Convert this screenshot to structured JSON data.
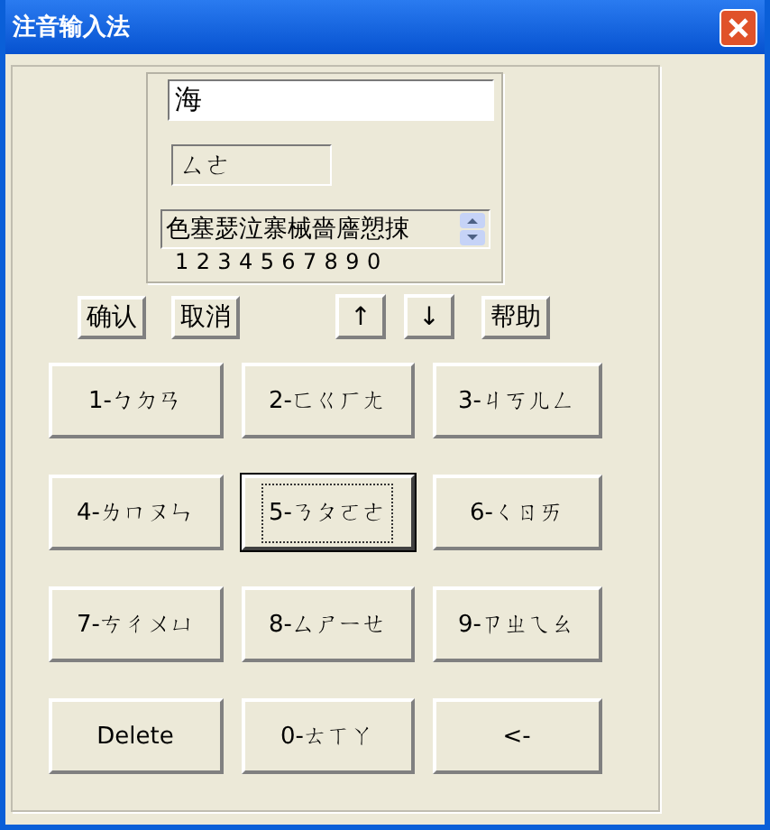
{
  "window": {
    "title": "注音输入法"
  },
  "composition": {
    "value": "海"
  },
  "phonetic": {
    "value": "ㄙㄜ"
  },
  "candidates": {
    "text": "色塞瑟泣寨械嗇廧愬捒",
    "numbers": [
      "1",
      "2",
      "3",
      "4",
      "5",
      "6",
      "7",
      "8",
      "9",
      "0"
    ]
  },
  "buttons": [
    {
      "label": "确认",
      "kind": "text"
    },
    {
      "label": "取消",
      "kind": "text"
    },
    {
      "label": "↑",
      "kind": "arrow"
    },
    {
      "label": "↓",
      "kind": "arrow"
    },
    {
      "label": "帮助",
      "kind": "help"
    }
  ],
  "keys": [
    {
      "label": "1-ㄅㄉㄢ",
      "focused": false
    },
    {
      "label": "2-ㄈㄍㄏㄤ",
      "focused": false
    },
    {
      "label": "3-ㄐㄎㄦㄥ",
      "focused": false
    },
    {
      "label": "4-ㄌㄇㄡㄣ",
      "focused": false
    },
    {
      "label": "5-ㄋㄆㄛㄜ",
      "focused": true
    },
    {
      "label": "6-ㄑㄖㄞ",
      "focused": false
    },
    {
      "label": "7-ㄘㄔㄨㄩ",
      "focused": false
    },
    {
      "label": "8-ㄙㄕㄧㄝ",
      "focused": false
    },
    {
      "label": "9-ㄗㄓㄟㄠ",
      "focused": false
    },
    {
      "label": "Delete",
      "focused": false
    },
    {
      "label": "0-ㄊㄒㄚ",
      "focused": false
    },
    {
      "label": "<-",
      "focused": false
    }
  ]
}
